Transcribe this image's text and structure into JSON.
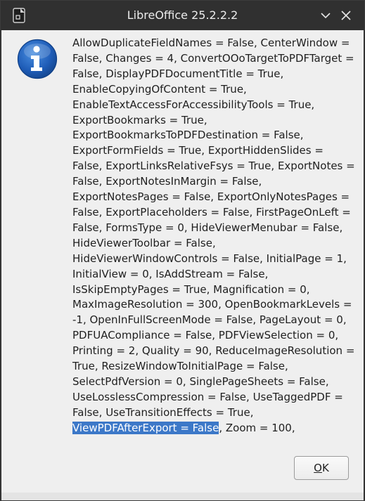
{
  "window": {
    "title": "LibreOffice 25.2.2.2"
  },
  "dialog": {
    "icon": "info-icon",
    "message_lines": [
      "AllowDuplicateFieldNames = False, CenterWindow =",
      "False, Changes = 4, ConvertOOoTargetToPDFTarget =",
      "False, DisplayPDFDocumentTitle = True,",
      "EnableCopyingOfContent = True,",
      "EnableTextAccessForAccessibilityTools = True,",
      "ExportBookmarks = True,",
      "ExportBookmarksToPDFDestination = False,",
      "ExportFormFields = True, ExportHiddenSlides =",
      "False, ExportLinksRelativeFsys = True, ExportNotes =",
      "False, ExportNotesInMargin = False,",
      "ExportNotesPages = False, ExportOnlyNotesPages =",
      "False, ExportPlaceholders = False, FirstPageOnLeft =",
      "False, FormsType = 0, HideViewerMenubar = False,",
      "HideViewerToolbar = False,",
      "HideViewerWindowControls = False, InitialPage = 1,",
      "InitialView = 0, IsAddStream = False,",
      "IsSkipEmptyPages = True, Magnification = 0,",
      "MaxImageResolution = 300, OpenBookmarkLevels =",
      "-1, OpenInFullScreenMode = False, PageLayout = 0,",
      "PDFUACompliance = False, PDFViewSelection = 0,",
      "Printing = 2, Quality = 90, ReduceImageResolution =",
      "True, ResizeWindowToInitialPage = False,",
      "SelectPdfVersion = 0, SinglePageSheets = False,",
      "UseLosslessCompression = False, UseTaggedPDF =",
      "False, UseTransitionEffects = True,"
    ],
    "last_line_selected": "ViewPDFAfterExport = False",
    "last_line_rest": ", Zoom = 100,",
    "ok_label_mnemonic": "O",
    "ok_label_rest": "K"
  },
  "colors": {
    "selection": "#3c78c8",
    "titlebar": "#303030",
    "dialog_bg": "#efefef"
  }
}
